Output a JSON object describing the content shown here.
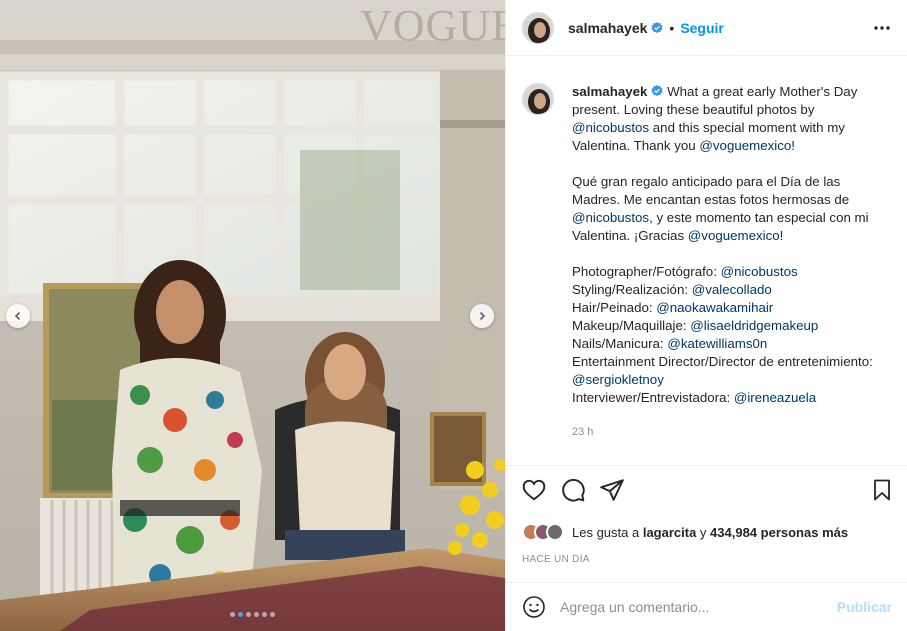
{
  "media": {
    "watermark": "VOGUE",
    "slide_count": 6,
    "active_slide": 2
  },
  "header": {
    "username": "salmahayek",
    "separator": "•",
    "follow_label": "Seguir",
    "more_icon": "more-horizontal-icon",
    "verified_color": "#3897f0"
  },
  "caption": {
    "username": "salmahayek",
    "en": {
      "text1": " What a great early Mother's Day present. Loving these beautiful photos by ",
      "m1": "@nicobustos",
      "text2": " and this special moment with my Valentina. Thank you ",
      "m2": "@voguemexico",
      "text3": "!"
    },
    "es": {
      "text1": "Qué gran regalo anticipado para el Día de las Madres. Me encantan estas fotos hermosas de ",
      "m1": "@nicobustos",
      "text2": ", y este momento tan especial con mi Valentina. ¡Gracias ",
      "m2": "@voguemexico",
      "text3": "!"
    },
    "credits": [
      {
        "label": "Photographer/Fotógrafo: ",
        "handle": "@nicobustos"
      },
      {
        "label": "Styling/Realización: ",
        "handle": "@valecollado"
      },
      {
        "label": "Hair/Peinado: ",
        "handle": "@naokawakamihair"
      },
      {
        "label": "Makeup/Maquillaje: ",
        "handle": "@lisaeldridgemakeup"
      },
      {
        "label": "Nails/Manicura: ",
        "handle": "@katewilliams0n"
      },
      {
        "label": "Entertainment Director/Director de entretenimiento: ",
        "handle": "@sergiokletnoy"
      },
      {
        "label": "Interviewer/Entrevistadora: ",
        "handle": "@ireneazuela"
      }
    ],
    "time": "23 h"
  },
  "likes": {
    "prefix": "Les gusta a ",
    "user": "lagarcita",
    "middle": " y ",
    "count": "434,984 personas más"
  },
  "posted_ago": "HACE UN DÍA",
  "comment": {
    "placeholder": "Agrega un comentario...",
    "publish_label": "Publicar"
  },
  "colors": {
    "link": "#00376b",
    "accent": "#0095f6",
    "publish_disabled": "#b2dffc"
  }
}
